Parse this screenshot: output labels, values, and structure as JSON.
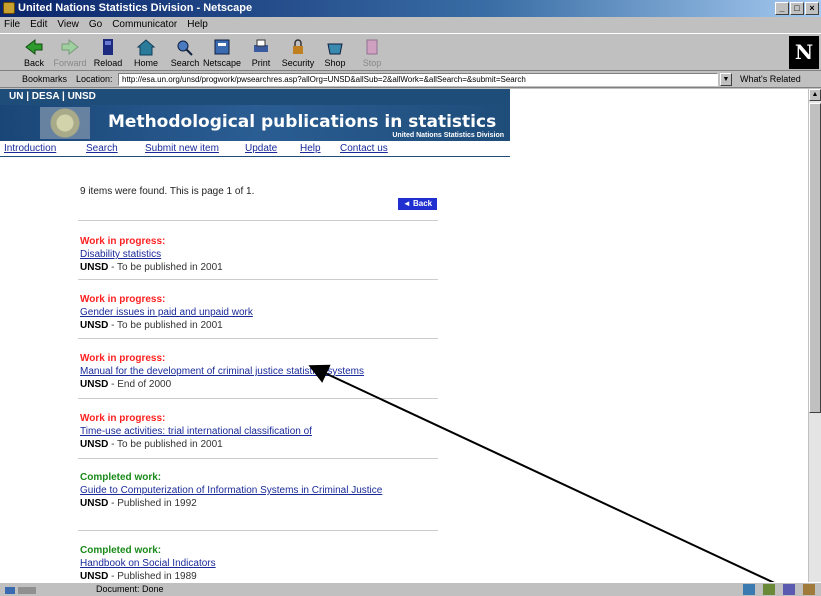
{
  "window": {
    "title": "United Nations Statistics Division - Netscape",
    "controls": [
      "_",
      "□",
      "×"
    ]
  },
  "menu": [
    "File",
    "Edit",
    "View",
    "Go",
    "Communicator",
    "Help"
  ],
  "toolbar": {
    "buttons": [
      {
        "label": "Back",
        "icon": "back-arrow-icon"
      },
      {
        "label": "Forward",
        "icon": "forward-arrow-icon"
      },
      {
        "label": "Reload",
        "icon": "reload-icon"
      },
      {
        "label": "Home",
        "icon": "home-icon"
      },
      {
        "label": "Search",
        "icon": "search-icon"
      },
      {
        "label": "Netscape",
        "icon": "netscape-icon"
      },
      {
        "label": "Print",
        "icon": "print-icon"
      },
      {
        "label": "Security",
        "icon": "lock-icon"
      },
      {
        "label": "Shop",
        "icon": "shop-icon"
      },
      {
        "label": "Stop",
        "icon": "stop-icon"
      }
    ],
    "logo": "N"
  },
  "location": {
    "bookmarks_label": "Bookmarks",
    "location_label": "Location:",
    "url": "http://esa.un.org/unsd/progwork/pwsearchres.asp?allOrg=UNSD&allSub=2&allWork=&allSearch=&submit=Search",
    "related_label": "What's Related"
  },
  "page": {
    "top_nav": "UN | DESA | UNSD",
    "title": "Methodological publications in statistics",
    "subtitle": "United Nations Statistics Division",
    "nav": [
      "Introduction",
      "Search",
      "Submit new item",
      "Update",
      "Help",
      "Contact us"
    ],
    "found_text": "9 items were found. This is page 1 of 1.",
    "back_button": "◄ Back",
    "items": [
      {
        "status": "Work in progress:",
        "title": "Disability statistics",
        "org": "UNSD",
        "note": " - To be published in 2001"
      },
      {
        "status": "Work in progress:",
        "title": "Gender issues in paid and unpaid work",
        "org": "UNSD",
        "note": " - To be published in 2001"
      },
      {
        "status": "Work in progress:",
        "title": "Manual for the development of criminal justice statistics systems",
        "org": "UNSD",
        "note": " - End of 2000"
      },
      {
        "status": "Work in progress:",
        "title": "Time-use activities: trial international classification of",
        "org": "UNSD",
        "note": " - To be published in 2001"
      },
      {
        "status": "Completed work:",
        "title": "Guide to Computerization of Information Systems in Criminal Justice",
        "org": "UNSD",
        "note": " - Published in 1992"
      },
      {
        "status": "Completed work:",
        "title": "Handbook on Social Indicators",
        "org": "UNSD",
        "note": " - Published in 1989"
      }
    ]
  },
  "statusbar": {
    "text": "Document: Done"
  },
  "colors": {
    "wip": "#ff2020",
    "done": "#1a8a1a",
    "link": "#1a2a9a",
    "banner": "#1f4d7a"
  }
}
